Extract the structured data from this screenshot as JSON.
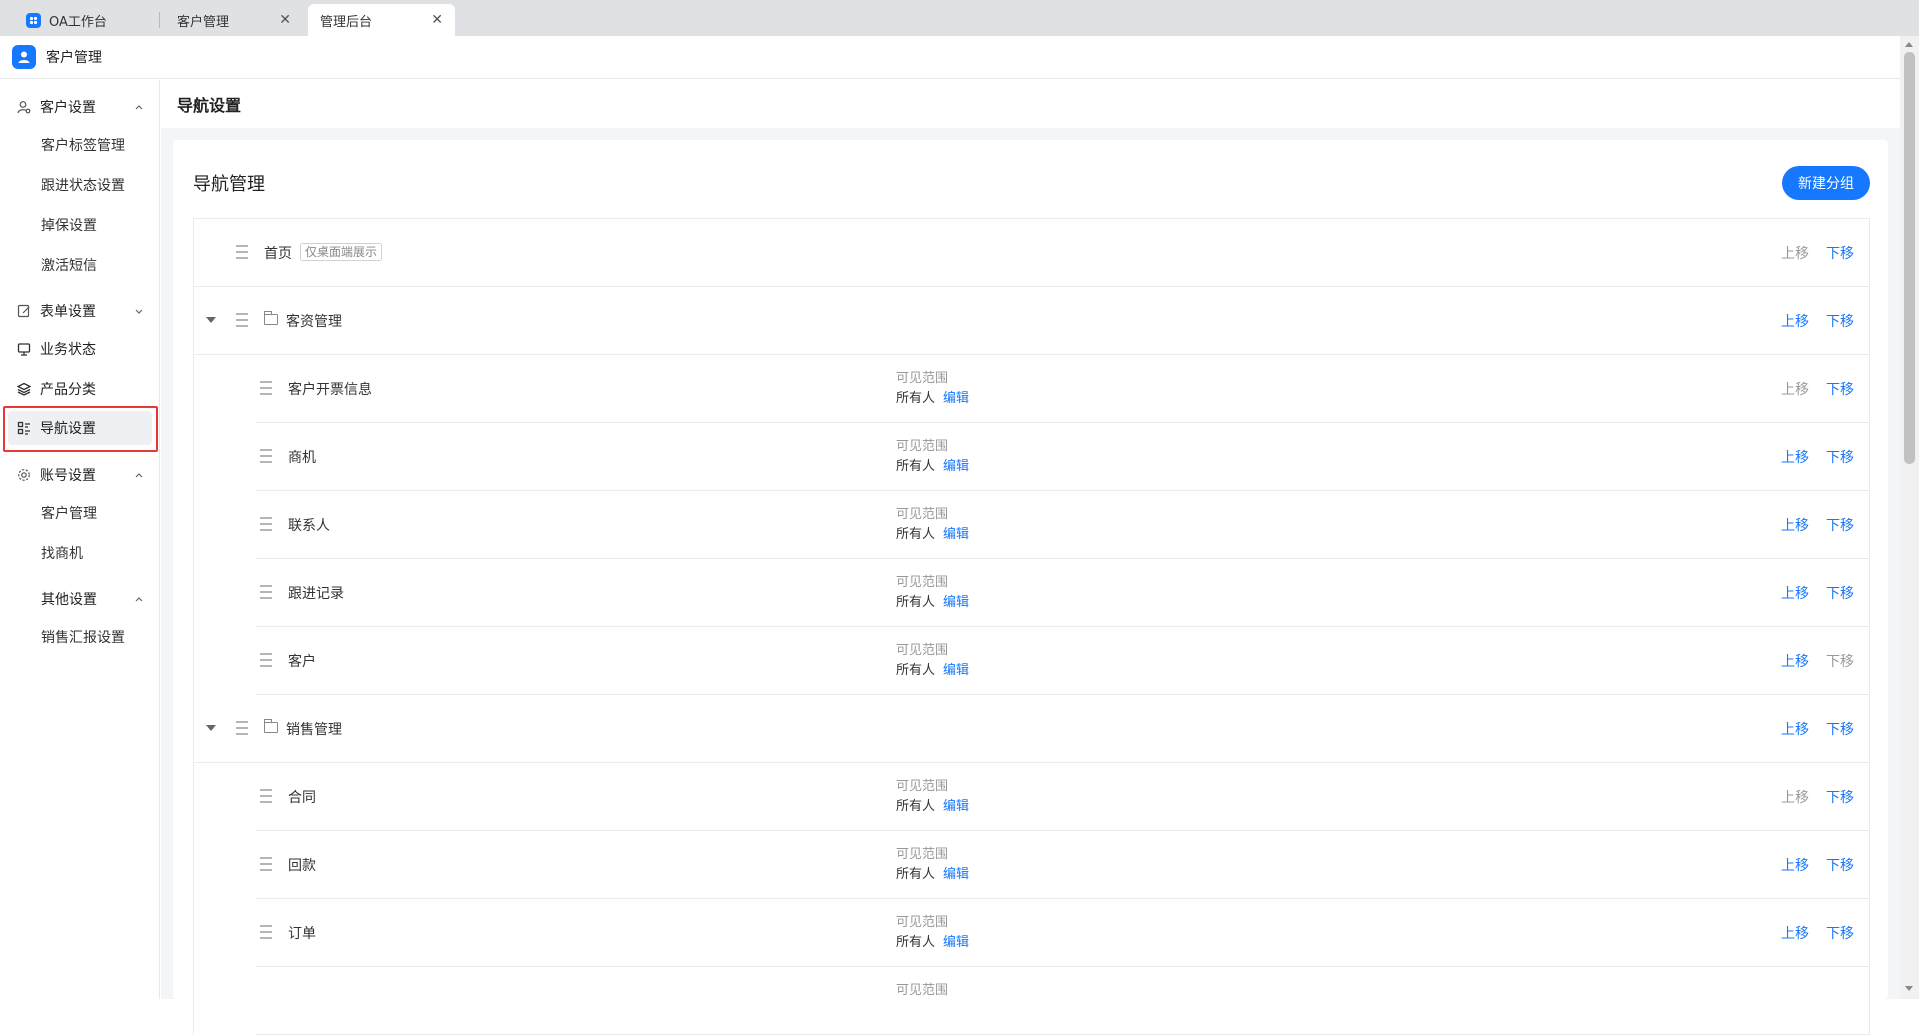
{
  "tabs": [
    {
      "label": "OA工作台"
    },
    {
      "label": "客户管理",
      "close": "✕"
    },
    {
      "label": "管理后台",
      "close": "✕"
    }
  ],
  "app": {
    "title": "客户管理"
  },
  "sidebar": {
    "groups": [
      {
        "label": "客户设置",
        "items": [
          {
            "label": "客户标签管理"
          },
          {
            "label": "跟进状态设置"
          },
          {
            "label": "掉保设置"
          },
          {
            "label": "激活短信"
          }
        ]
      },
      {
        "label": "表单设置"
      },
      {
        "label": "业务状态"
      },
      {
        "label": "产品分类"
      },
      {
        "label": "导航设置"
      },
      {
        "label": "账号设置",
        "items": [
          {
            "label": "客户管理"
          },
          {
            "label": "找商机"
          }
        ]
      },
      {
        "label": "其他设置",
        "items": [
          {
            "label": "销售汇报设置"
          }
        ]
      }
    ],
    "active_item": "导航设置"
  },
  "page": {
    "title": "导航设置"
  },
  "card": {
    "title": "导航管理",
    "new_group_button": "新建分组"
  },
  "common": {
    "scope_label": "可见范围",
    "scope_value": "所有人",
    "edit": "编辑",
    "move_up": "上移",
    "move_down": "下移"
  },
  "rows": [
    {
      "name": "首页",
      "tag": "仅桌面端展示",
      "up_enabled": false,
      "down_enabled": true
    },
    {
      "name": "客资管理",
      "folder": true,
      "up_enabled": true,
      "down_enabled": true
    },
    {
      "name": "客户开票信息",
      "child": true,
      "up_enabled": false,
      "down_enabled": true
    },
    {
      "name": "商机",
      "child": true,
      "up_enabled": true,
      "down_enabled": true
    },
    {
      "name": "联系人",
      "child": true,
      "up_enabled": true,
      "down_enabled": true
    },
    {
      "name": "跟进记录",
      "child": true,
      "up_enabled": true,
      "down_enabled": true
    },
    {
      "name": "客户",
      "child": true,
      "up_enabled": true,
      "down_enabled": false
    },
    {
      "name": "销售管理",
      "folder": true,
      "up_enabled": true,
      "down_enabled": true
    },
    {
      "name": "合同",
      "child": true,
      "up_enabled": false,
      "down_enabled": true
    },
    {
      "name": "回款",
      "child": true,
      "up_enabled": true,
      "down_enabled": true
    },
    {
      "name": "订单",
      "child": true,
      "up_enabled": true,
      "down_enabled": true
    },
    {
      "name": "",
      "child": true,
      "partial": true
    }
  ],
  "colors": {
    "accent": "#1677ff",
    "highlight_border": "#e53935"
  }
}
